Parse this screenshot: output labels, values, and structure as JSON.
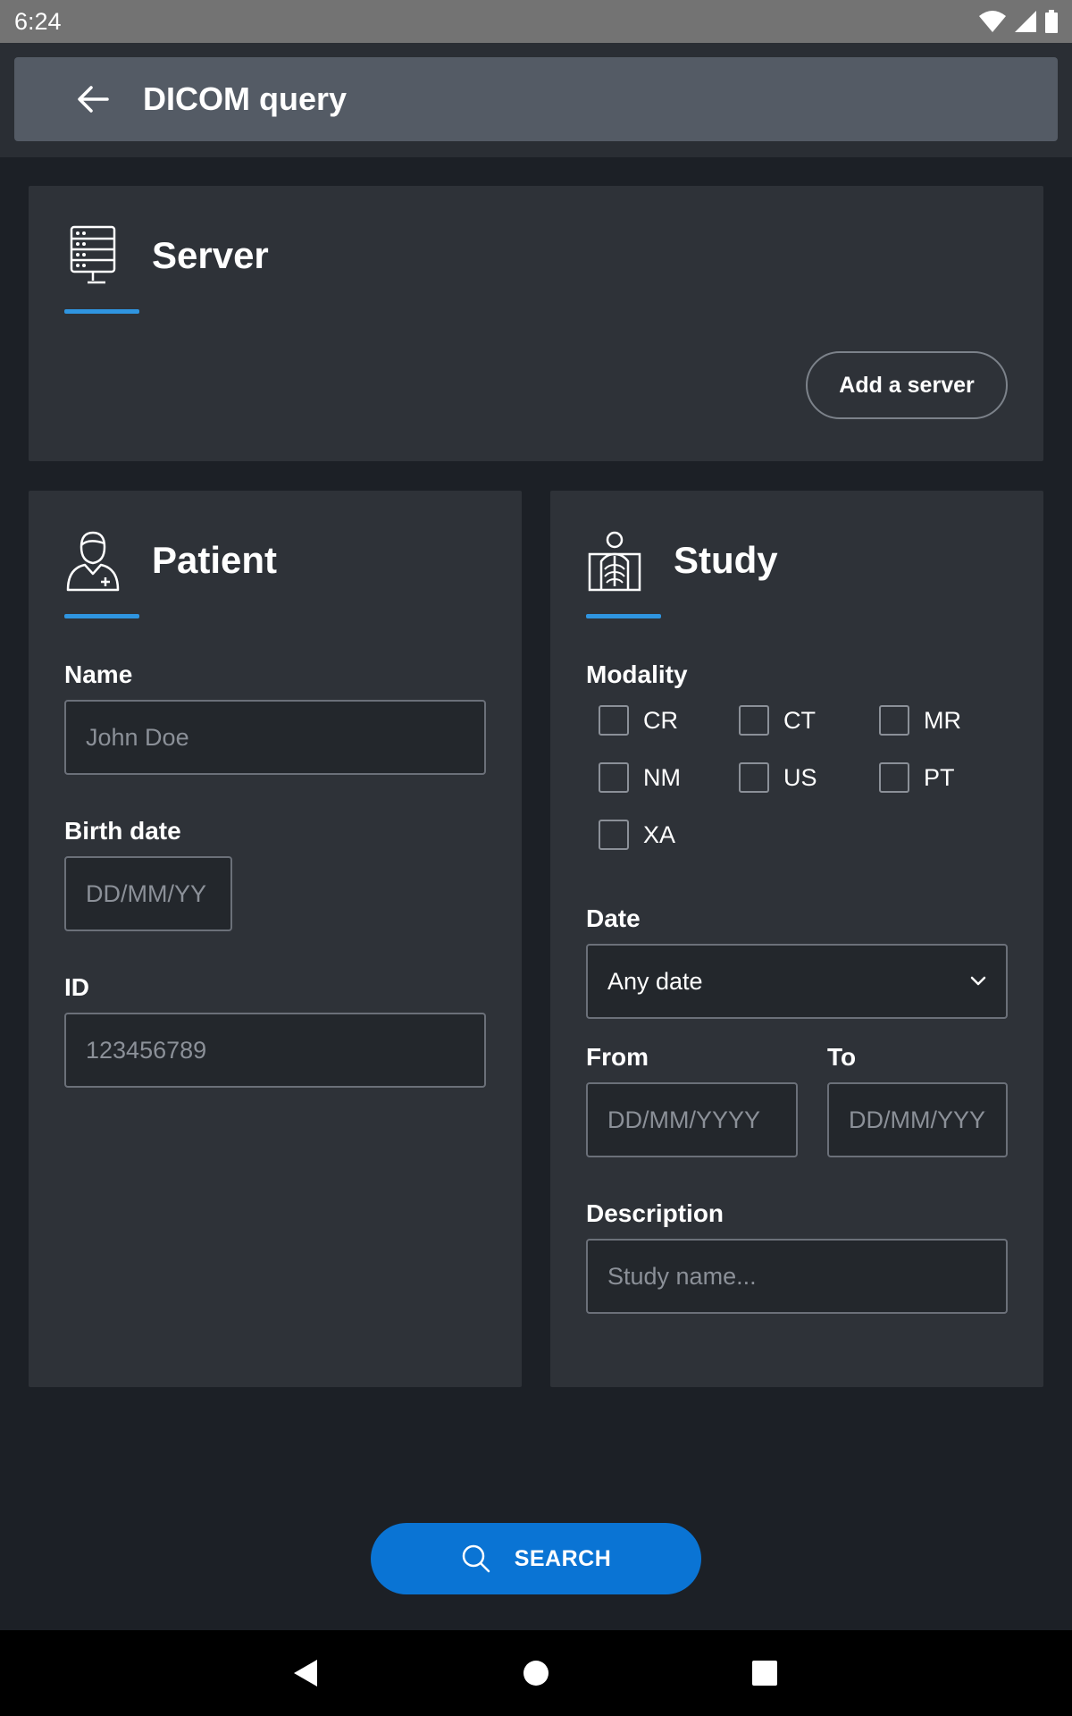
{
  "status_bar": {
    "time": "6:24"
  },
  "app_bar": {
    "title": "DICOM query"
  },
  "server": {
    "title": "Server",
    "add_button": "Add a server"
  },
  "patient": {
    "title": "Patient",
    "name": {
      "label": "Name",
      "placeholder": "John Doe",
      "value": ""
    },
    "birth_date": {
      "label": "Birth date",
      "placeholder": "DD/MM/YY",
      "value": ""
    },
    "id": {
      "label": "ID",
      "placeholder": "123456789",
      "value": ""
    }
  },
  "study": {
    "title": "Study",
    "modality_label": "Modality",
    "modalities": [
      {
        "label": "CR",
        "checked": false
      },
      {
        "label": "CT",
        "checked": false
      },
      {
        "label": "MR",
        "checked": false
      },
      {
        "label": "NM",
        "checked": false
      },
      {
        "label": "US",
        "checked": false
      },
      {
        "label": "PT",
        "checked": false
      },
      {
        "label": "XA",
        "checked": false
      }
    ],
    "date": {
      "label": "Date",
      "selected": "Any date"
    },
    "from": {
      "label": "From",
      "placeholder": "DD/MM/YYYY",
      "value": ""
    },
    "to": {
      "label": "To",
      "placeholder": "DD/MM/YYYY",
      "value": ""
    },
    "description": {
      "label": "Description",
      "placeholder": "Study name...",
      "value": ""
    }
  },
  "search_button": {
    "label": "SEARCH"
  },
  "colors": {
    "accent": "#2f95e0",
    "primary_button": "#0a74d4",
    "background": "#1c2026",
    "card": "#2e3238",
    "app_bar": "#545b65"
  },
  "icons": {
    "back": "arrow-left-icon",
    "server": "server-rack-icon",
    "patient": "patient-icon",
    "study": "xray-chest-icon",
    "dropdown": "chevron-down-icon",
    "search": "search-icon",
    "nav_back": "nav-back-icon",
    "nav_home": "nav-home-icon",
    "nav_recents": "nav-recents-icon"
  }
}
